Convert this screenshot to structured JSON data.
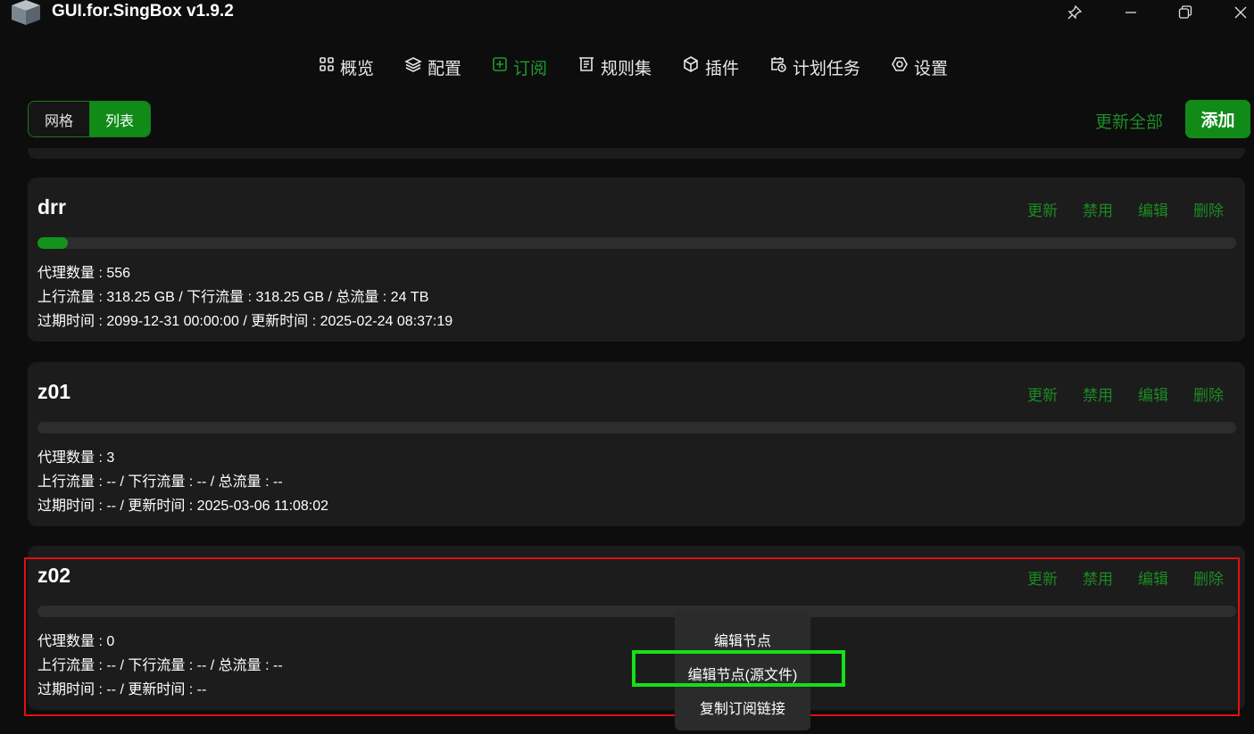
{
  "window": {
    "title": "GUI.for.SingBox v1.9.2",
    "icons": [
      "cube-logo-icon",
      "pin-icon",
      "minimize-icon",
      "restore-icon",
      "close-icon"
    ]
  },
  "nav": {
    "items": [
      {
        "label": "概览",
        "icon": "grid-icon",
        "active": false
      },
      {
        "label": "配置",
        "icon": "layers-icon",
        "active": false
      },
      {
        "label": "订阅",
        "icon": "subscribe-icon",
        "active": true
      },
      {
        "label": "规则集",
        "icon": "ruleset-icon",
        "active": false
      },
      {
        "label": "插件",
        "icon": "box-icon",
        "active": false
      },
      {
        "label": "计划任务",
        "icon": "calendar-clock-icon",
        "active": false
      },
      {
        "label": "设置",
        "icon": "settings-icon",
        "active": false
      }
    ],
    "active_color": "#1f9a2e"
  },
  "toolbar": {
    "view_grid": "网格",
    "view_list": "列表",
    "view_selected": "列表",
    "update_all": "更新全部",
    "add": "添加"
  },
  "card_actions": {
    "update": "更新",
    "disable": "禁用",
    "edit": "编辑",
    "delete": "删除"
  },
  "subscriptions": [
    {
      "name": "drr",
      "usage_fraction": 0.025,
      "proxies": "代理数量 : 556",
      "traffic": "上行流量 : 318.25 GB / 下行流量 : 318.25 GB / 总流量 : 24 TB",
      "times": "过期时间 : 2099-12-31 00:00:00 / 更新时间 : 2025-02-24 08:37:19"
    },
    {
      "name": "z01",
      "usage_fraction": 0,
      "proxies": "代理数量 : 3",
      "traffic": "上行流量 : -- / 下行流量 : -- / 总流量 : --",
      "times": "过期时间 : -- / 更新时间 : 2025-03-06 11:08:02"
    },
    {
      "name": "z02",
      "usage_fraction": 0,
      "proxies": "代理数量 : 0",
      "traffic": "上行流量 : -- / 下行流量 : -- / 总流量 : --",
      "times": "过期时间 : -- / 更新时间 : --"
    }
  ],
  "context_menu": {
    "items": [
      "编辑节点",
      "编辑节点(源文件)",
      "复制订阅链接"
    ]
  },
  "colors": {
    "accent": "#118a18",
    "action_text": "#1c8a24",
    "annotation_red": "#e01010",
    "annotation_green": "#16e016"
  }
}
